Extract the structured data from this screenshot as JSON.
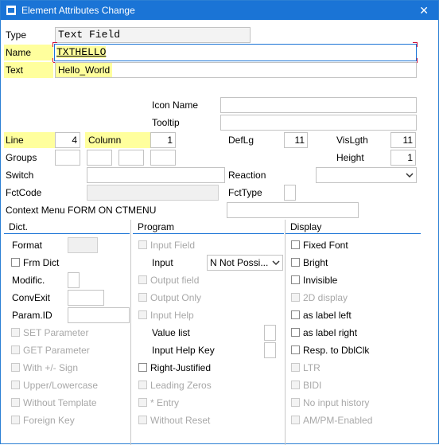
{
  "window": {
    "title": "Element Attributes Change",
    "close": "✕"
  },
  "top": {
    "type_label": "Type",
    "type_value": "Text Field",
    "name_label": "Name",
    "name_value": "TXTHELLO",
    "text_label": "Text",
    "text_value": "Hello_World"
  },
  "mid": {
    "icon_name_label": "Icon Name",
    "icon_name_value": "",
    "tooltip_label": "Tooltip",
    "tooltip_value": "",
    "line_label": "Line",
    "line_value": "4",
    "column_label": "Column",
    "column_value": "1",
    "deflg_label": "DefLg",
    "deflg_value": "11",
    "vislgth_label": "VisLgth",
    "vislgth_value": "11",
    "groups_label": "Groups",
    "height_label": "Height",
    "height_value": "1",
    "switch_label": "Switch",
    "switch_value": "",
    "reaction_label": "Reaction",
    "reaction_value": "",
    "fctcode_label": "FctCode",
    "fctcode_value": "",
    "fcttype_label": "FctType",
    "fcttype_value": "",
    "context_label": "Context Menu FORM ON CTMENU",
    "context_value": ""
  },
  "dict": {
    "header": "Dict.",
    "format_label": "Format",
    "frm_dict_label": "Frm Dict",
    "modific_label": "Modific.",
    "convexit_label": "ConvExit",
    "paramid_label": "Param.ID",
    "set_param": "SET Parameter",
    "get_param": "GET Parameter",
    "with_sign": "With +/- Sign",
    "upper_lower": "Upper/Lowercase",
    "without_template": "Without Template",
    "foreign_key": "Foreign Key"
  },
  "program": {
    "header": "Program",
    "input_field": "Input Field",
    "input_label": "Input",
    "input_value": "N Not Possi...",
    "output_field": "Output field",
    "output_only": "Output Only",
    "input_help": "Input Help",
    "value_list": "Value list",
    "input_help_key": "Input Help Key",
    "right_justified": "Right-Justified",
    "leading_zeros": "Leading Zeros",
    "entry": "* Entry",
    "without_reset": "Without Reset"
  },
  "display": {
    "header": "Display",
    "fixed_font": "Fixed Font",
    "bright": "Bright",
    "invisible": "Invisible",
    "display_2d": "2D display",
    "label_left": "as label left",
    "label_right": "as label right",
    "resp_dblclk": "Resp. to DblClk",
    "ltr": "LTR",
    "bidi": "BIDI",
    "no_input_history": "No input history",
    "ampm": "AM/PM-Enabled"
  },
  "colors": {
    "title_bar": "#1a74d6",
    "highlight": "#ffff9d",
    "section_line": "#1a74d6"
  }
}
